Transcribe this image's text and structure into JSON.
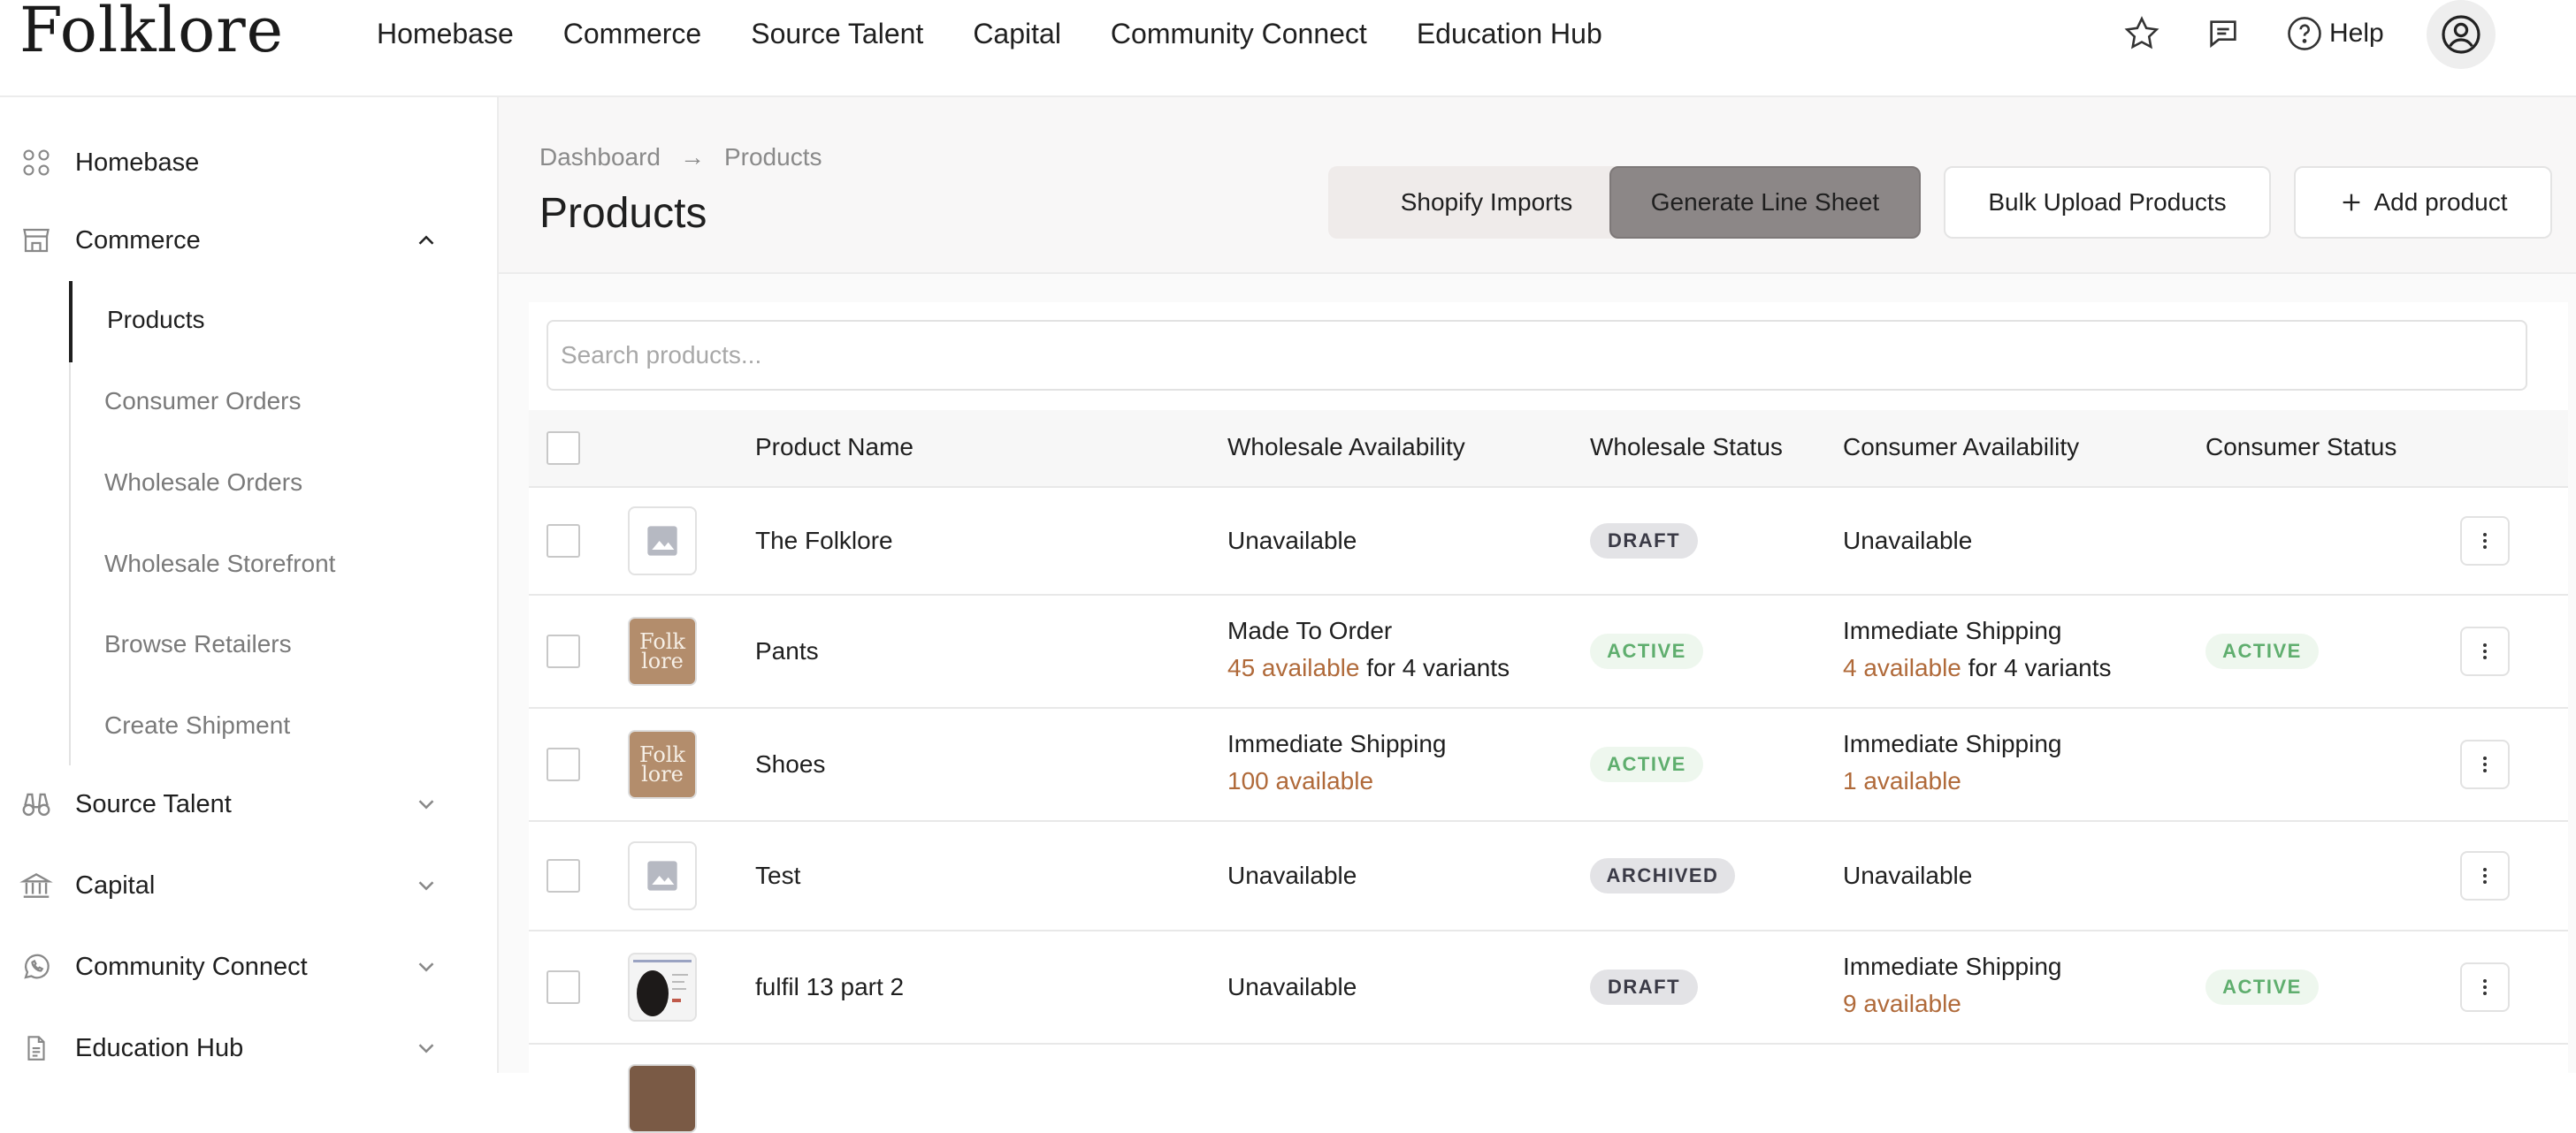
{
  "brand": {
    "logo_text": "Folklore"
  },
  "topnav": {
    "links": [
      "Homebase",
      "Commerce",
      "Source Talent",
      "Capital",
      "Community Connect",
      "Education Hub"
    ],
    "help_label": "Help"
  },
  "sidebar": {
    "homebase": "Homebase",
    "commerce": "Commerce",
    "commerce_items": [
      "Products",
      "Consumer Orders",
      "Wholesale Orders",
      "Wholesale Storefront",
      "Browse Retailers",
      "Create Shipment"
    ],
    "source_talent": "Source Talent",
    "capital": "Capital",
    "community_connect": "Community Connect",
    "education_hub": "Education Hub"
  },
  "breadcrumb": {
    "parent": "Dashboard",
    "arrow": "→",
    "current": "Products"
  },
  "page_title": "Products",
  "actions": {
    "shopify": "Shopify Imports",
    "generate": "Generate Line Sheet",
    "bulk": "Bulk Upload Products",
    "add": "Add product"
  },
  "search": {
    "placeholder": "Search products..."
  },
  "table": {
    "headers": [
      "Product Name",
      "Wholesale Availability",
      "Wholesale Status",
      "Consumer Availability",
      "Consumer Status"
    ],
    "rows": [
      {
        "name": "The Folklore",
        "w_line1": "Unavailable",
        "w_avail": "",
        "w_suffix": "",
        "w_status": "DRAFT",
        "c_line1": "Unavailable",
        "c_avail": "",
        "c_suffix": "",
        "c_status": ""
      },
      {
        "name": "Pants",
        "w_line1": "Made To Order",
        "w_avail": "45 available",
        "w_suffix": " for 4 variants",
        "w_status": "ACTIVE",
        "c_line1": "Immediate Shipping",
        "c_avail": "4 available",
        "c_suffix": " for 4 variants",
        "c_status": "ACTIVE"
      },
      {
        "name": "Shoes",
        "w_line1": "Immediate Shipping",
        "w_avail": "100 available",
        "w_suffix": "",
        "w_status": "ACTIVE",
        "c_line1": "Immediate Shipping",
        "c_avail": "1 available",
        "c_suffix": "",
        "c_status": ""
      },
      {
        "name": "Test",
        "w_line1": "Unavailable",
        "w_avail": "",
        "w_suffix": "",
        "w_status": "ARCHIVED",
        "c_line1": "Unavailable",
        "c_avail": "",
        "c_suffix": "",
        "c_status": ""
      },
      {
        "name": "fulfil 13 part 2",
        "w_line1": "Unavailable",
        "w_avail": "",
        "w_suffix": "",
        "w_status": "DRAFT",
        "c_line1": "Immediate Shipping",
        "c_avail": "9 available",
        "c_suffix": "",
        "c_status": "ACTIVE"
      }
    ],
    "thumb_brand_text": [
      "Folk",
      "lore"
    ]
  },
  "colors": {
    "accent_orange": "#b06a3a",
    "active_green": "#5fae6e",
    "draft_bg": "#e3e3e6"
  }
}
